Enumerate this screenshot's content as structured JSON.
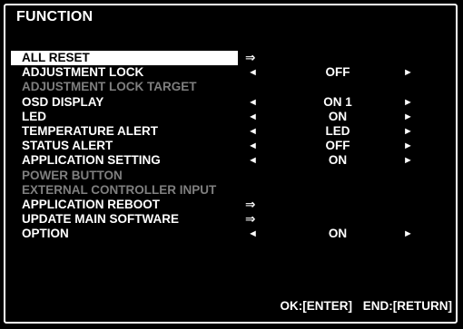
{
  "menu": {
    "title": "FUNCTION",
    "items": [
      {
        "label": "ALL RESET",
        "action": "⇒",
        "selected": true
      },
      {
        "label": "ADJUSTMENT LOCK",
        "left": "◄",
        "value": "OFF",
        "right": "►"
      },
      {
        "label": "ADJUSTMENT LOCK TARGET",
        "disabled": true
      },
      {
        "label": "OSD DISPLAY",
        "left": "◄",
        "value": "ON 1",
        "right": "►"
      },
      {
        "label": "LED",
        "left": "◄",
        "value": "ON",
        "right": "►"
      },
      {
        "label": "TEMPERATURE ALERT",
        "left": "◄",
        "value": "LED",
        "right": "►"
      },
      {
        "label": "STATUS ALERT",
        "left": "◄",
        "value": "OFF",
        "right": "►"
      },
      {
        "label": "APPLICATION SETTING",
        "left": "◄",
        "value": "ON",
        "right": "►"
      },
      {
        "label": "POWER BUTTON",
        "disabled": true
      },
      {
        "label": "EXTERNAL CONTROLLER INPUT",
        "disabled": true
      },
      {
        "label": "APPLICATION REBOOT",
        "action": "⇒"
      },
      {
        "label": "UPDATE MAIN SOFTWARE",
        "action": "⇒"
      },
      {
        "label": "OPTION",
        "left": "◄",
        "value": "ON",
        "right": "►"
      }
    ]
  },
  "footer": {
    "ok": "OK:[ENTER]",
    "end": "END:[RETURN]"
  },
  "colors": {
    "background": "#000000",
    "text": "#ffffff",
    "disabled": "#7f7f7f",
    "highlight": "#ffffff"
  }
}
